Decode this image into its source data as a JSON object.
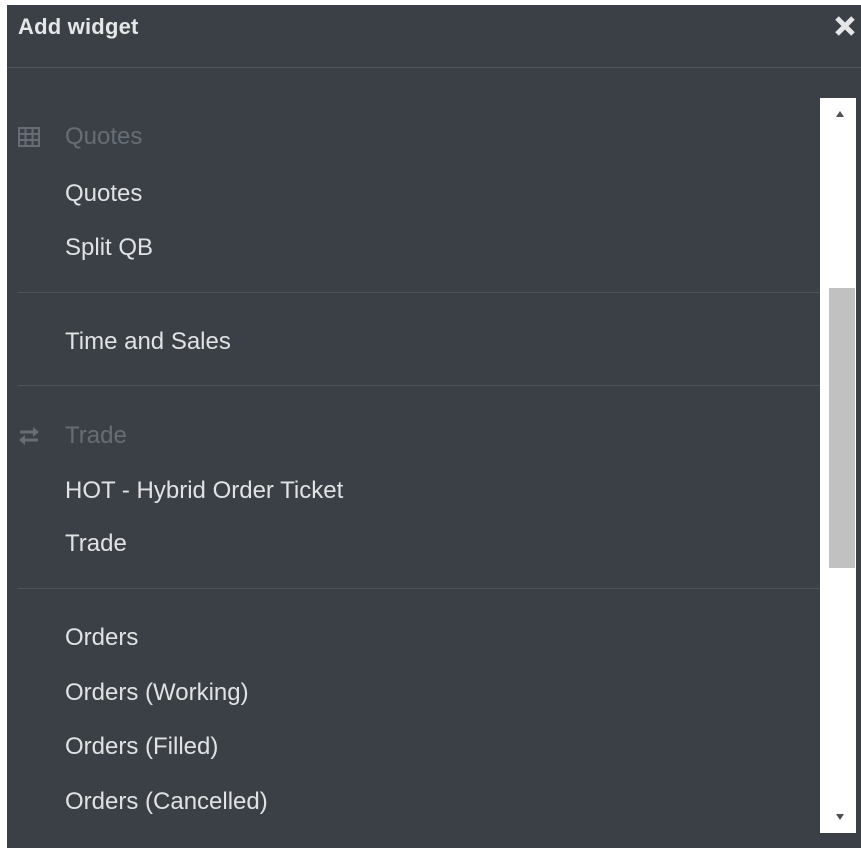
{
  "dialog": {
    "title": "Add widget",
    "close_icon": "close-icon"
  },
  "groups": [
    {
      "label": "Quotes",
      "icon": "table-icon",
      "items": [
        "Quotes",
        "Split QB"
      ]
    },
    {
      "label": "",
      "icon": "",
      "items": [
        "Time and Sales"
      ]
    },
    {
      "label": "Trade",
      "icon": "swap-arrows-icon",
      "items": [
        "HOT - Hybrid Order Ticket",
        "Trade"
      ]
    },
    {
      "label": "",
      "icon": "",
      "items": [
        "Orders",
        "Orders (Working)",
        "Orders (Filled)",
        "Orders (Cancelled)"
      ]
    }
  ],
  "scrollbar": {
    "position_fraction": 0.35,
    "up_icon": "arrow-up-icon",
    "down_icon": "arrow-down-icon"
  },
  "colors": {
    "background": "#3b4047",
    "item_text": "#e0e2e4",
    "group_label": "#676d74",
    "divider": "#4d535a"
  }
}
